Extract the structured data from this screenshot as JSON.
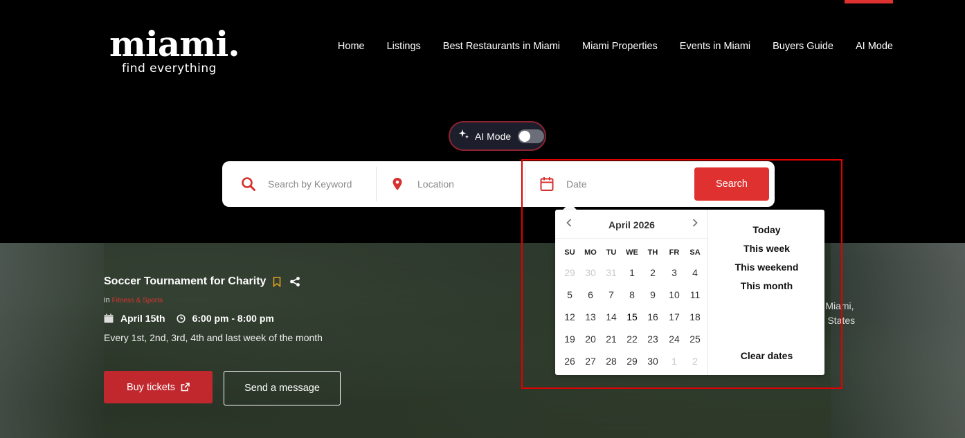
{
  "brand": {
    "name": "miami.",
    "tagline": "find everything"
  },
  "nav": [
    "Home",
    "Listings",
    "Best Restaurants in Miami",
    "Miami Properties",
    "Events in Miami",
    "Buyers Guide",
    "AI Mode"
  ],
  "ai_toggle": {
    "label": "AI Mode",
    "enabled": false
  },
  "search": {
    "keyword_placeholder": "Search by Keyword",
    "location_placeholder": "Location",
    "date_placeholder": "Date",
    "button_label": "Search"
  },
  "event": {
    "title": "Soccer Tournament for Charity",
    "in_label": "in",
    "category": "Fitness & Sports",
    "date": "April 15th",
    "time": "6:00 pm - 8:00 pm",
    "recurrence": "Every 1st, 2nd, 3rd, 4th and last week of the month",
    "buy_label": "Buy tickets",
    "message_label": "Send a message",
    "location_partial_1": "¸ , Miami,",
    "location_partial_2": "ed States"
  },
  "calendar": {
    "month": "April 2026",
    "weekdays": [
      "SU",
      "MO",
      "TU",
      "WE",
      "TH",
      "FR",
      "SA"
    ],
    "weeks": [
      [
        "29",
        "30",
        "31",
        "1",
        "2",
        "3",
        "4"
      ],
      [
        "5",
        "6",
        "7",
        "8",
        "9",
        "10",
        "11"
      ],
      [
        "12",
        "13",
        "14",
        "15",
        "16",
        "17",
        "18"
      ],
      [
        "19",
        "20",
        "21",
        "22",
        "23",
        "24",
        "25"
      ],
      [
        "26",
        "27",
        "28",
        "29",
        "30",
        "1",
        "2"
      ]
    ],
    "presets": [
      "Today",
      "This week",
      "This weekend",
      "This month"
    ],
    "clear_label": "Clear dates"
  },
  "colors": {
    "accent": "#e03131",
    "highlight": "#e00000"
  }
}
